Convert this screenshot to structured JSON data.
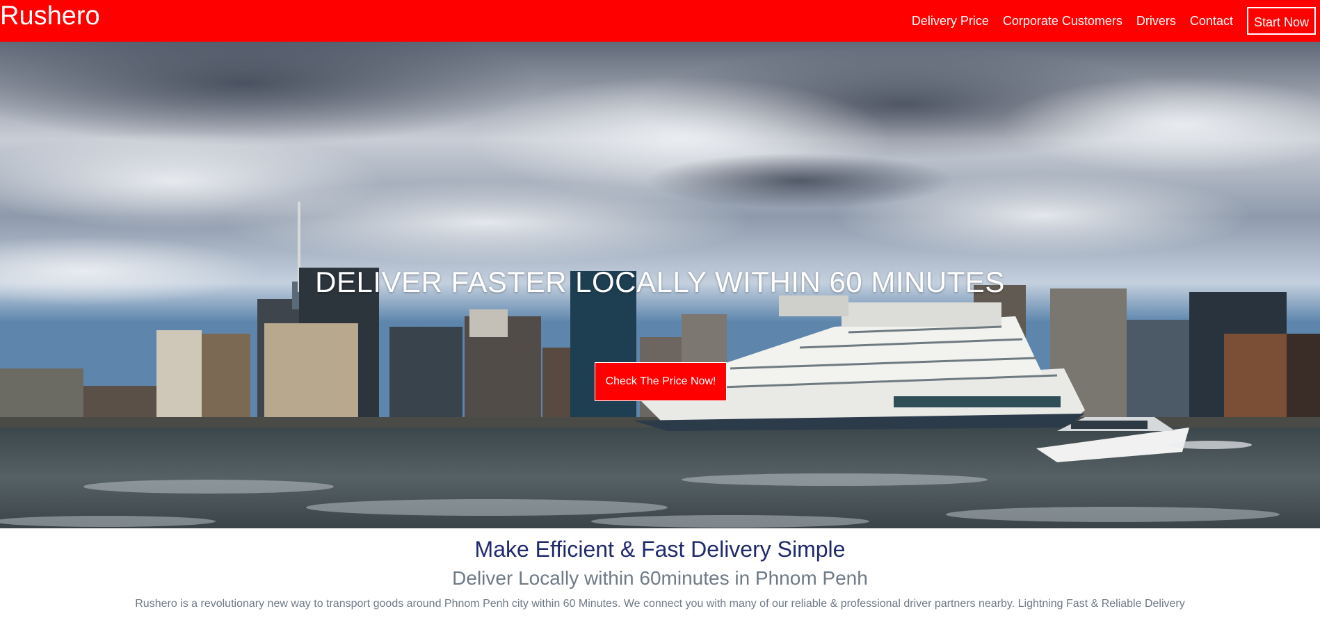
{
  "navbar": {
    "brand": "Rushero",
    "links": [
      {
        "label": "Delivery Price"
      },
      {
        "label": "Corporate Customers"
      },
      {
        "label": "Drivers"
      },
      {
        "label": "Contact"
      }
    ],
    "cta_label": "Start Now",
    "bg_color": "#ff0000"
  },
  "hero": {
    "title": "DELIVER FASTER LOCALLY WITHIN 60 MINUTES",
    "button_label": "Check The Price Now!",
    "image_description_icon": "harbor-cruise-ship-photo"
  },
  "about": {
    "title": "Make Efficient & Fast Delivery Simple",
    "subtitle": "Deliver Locally within 60minutes in Phnom Penh",
    "text": "Rushero is a revolutionary new way to transport goods around Phnom Penh city within 60 Minutes. We connect you with many of our reliable & professional driver partners nearby. Lightning Fast & Reliable Delivery"
  },
  "colors": {
    "accent": "#ff0000",
    "heading": "#1f2a6b",
    "muted": "#6f7a86"
  }
}
